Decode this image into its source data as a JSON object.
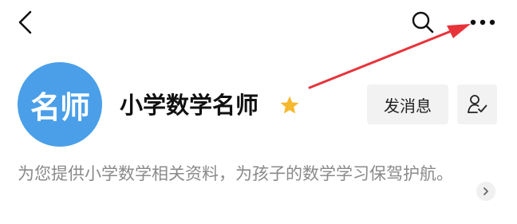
{
  "header": {
    "back_icon": "chevron-left-icon",
    "search_icon": "search-icon",
    "more_icon": "more-horizontal-icon"
  },
  "profile": {
    "avatar_text": "名师",
    "avatar_color": "#4a9fe8",
    "name": "小学数学名师",
    "badge_icon": "star-icon",
    "badge_color": "#f5b82e",
    "message_button_label": "发消息",
    "follow_icon": "user-check-icon"
  },
  "description": {
    "text": "为您提供小学数学相关资料，为孩子的数学学习保驾护航。",
    "expand_icon": "chevron-right-icon"
  },
  "annotation": {
    "arrow_color": "#e8333a"
  }
}
